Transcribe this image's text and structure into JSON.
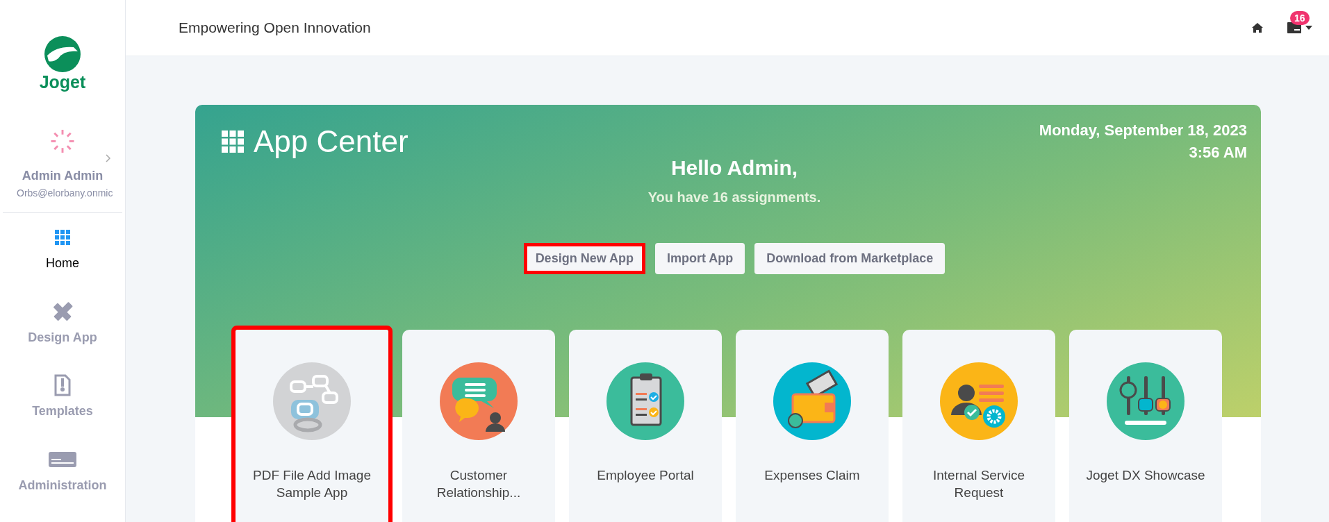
{
  "sidebar": {
    "logo_text": "Joget",
    "user": {
      "name": "Admin Admin",
      "email": "Orbs@elorbany.onmic"
    },
    "items": [
      {
        "label": "Home",
        "selected": true
      },
      {
        "label": "Design App",
        "selected": false
      },
      {
        "label": "Templates",
        "selected": false
      },
      {
        "label": "Administration",
        "selected": false
      }
    ]
  },
  "header": {
    "title": "Empowering Open Innovation",
    "notification_count": "16"
  },
  "app_center": {
    "title": "App Center",
    "date": "Monday, September 18, 2023",
    "time": "3:56 AM",
    "greeting": "Hello Admin,",
    "assignments": "You have 16 assignments.",
    "buttons": [
      {
        "label": "Design New App",
        "highlighted": true
      },
      {
        "label": "Import App",
        "highlighted": false
      },
      {
        "label": "Download from Marketplace",
        "highlighted": false
      }
    ],
    "apps": [
      {
        "name": "PDF File Add Image Sample App",
        "highlighted": true
      },
      {
        "name": "Customer Relationship...",
        "highlighted": false
      },
      {
        "name": "Employee Portal",
        "highlighted": false
      },
      {
        "name": "Expenses Claim",
        "highlighted": false
      },
      {
        "name": "Internal Service Request",
        "highlighted": false
      },
      {
        "name": "Joget DX Showcase",
        "highlighted": false
      }
    ]
  }
}
